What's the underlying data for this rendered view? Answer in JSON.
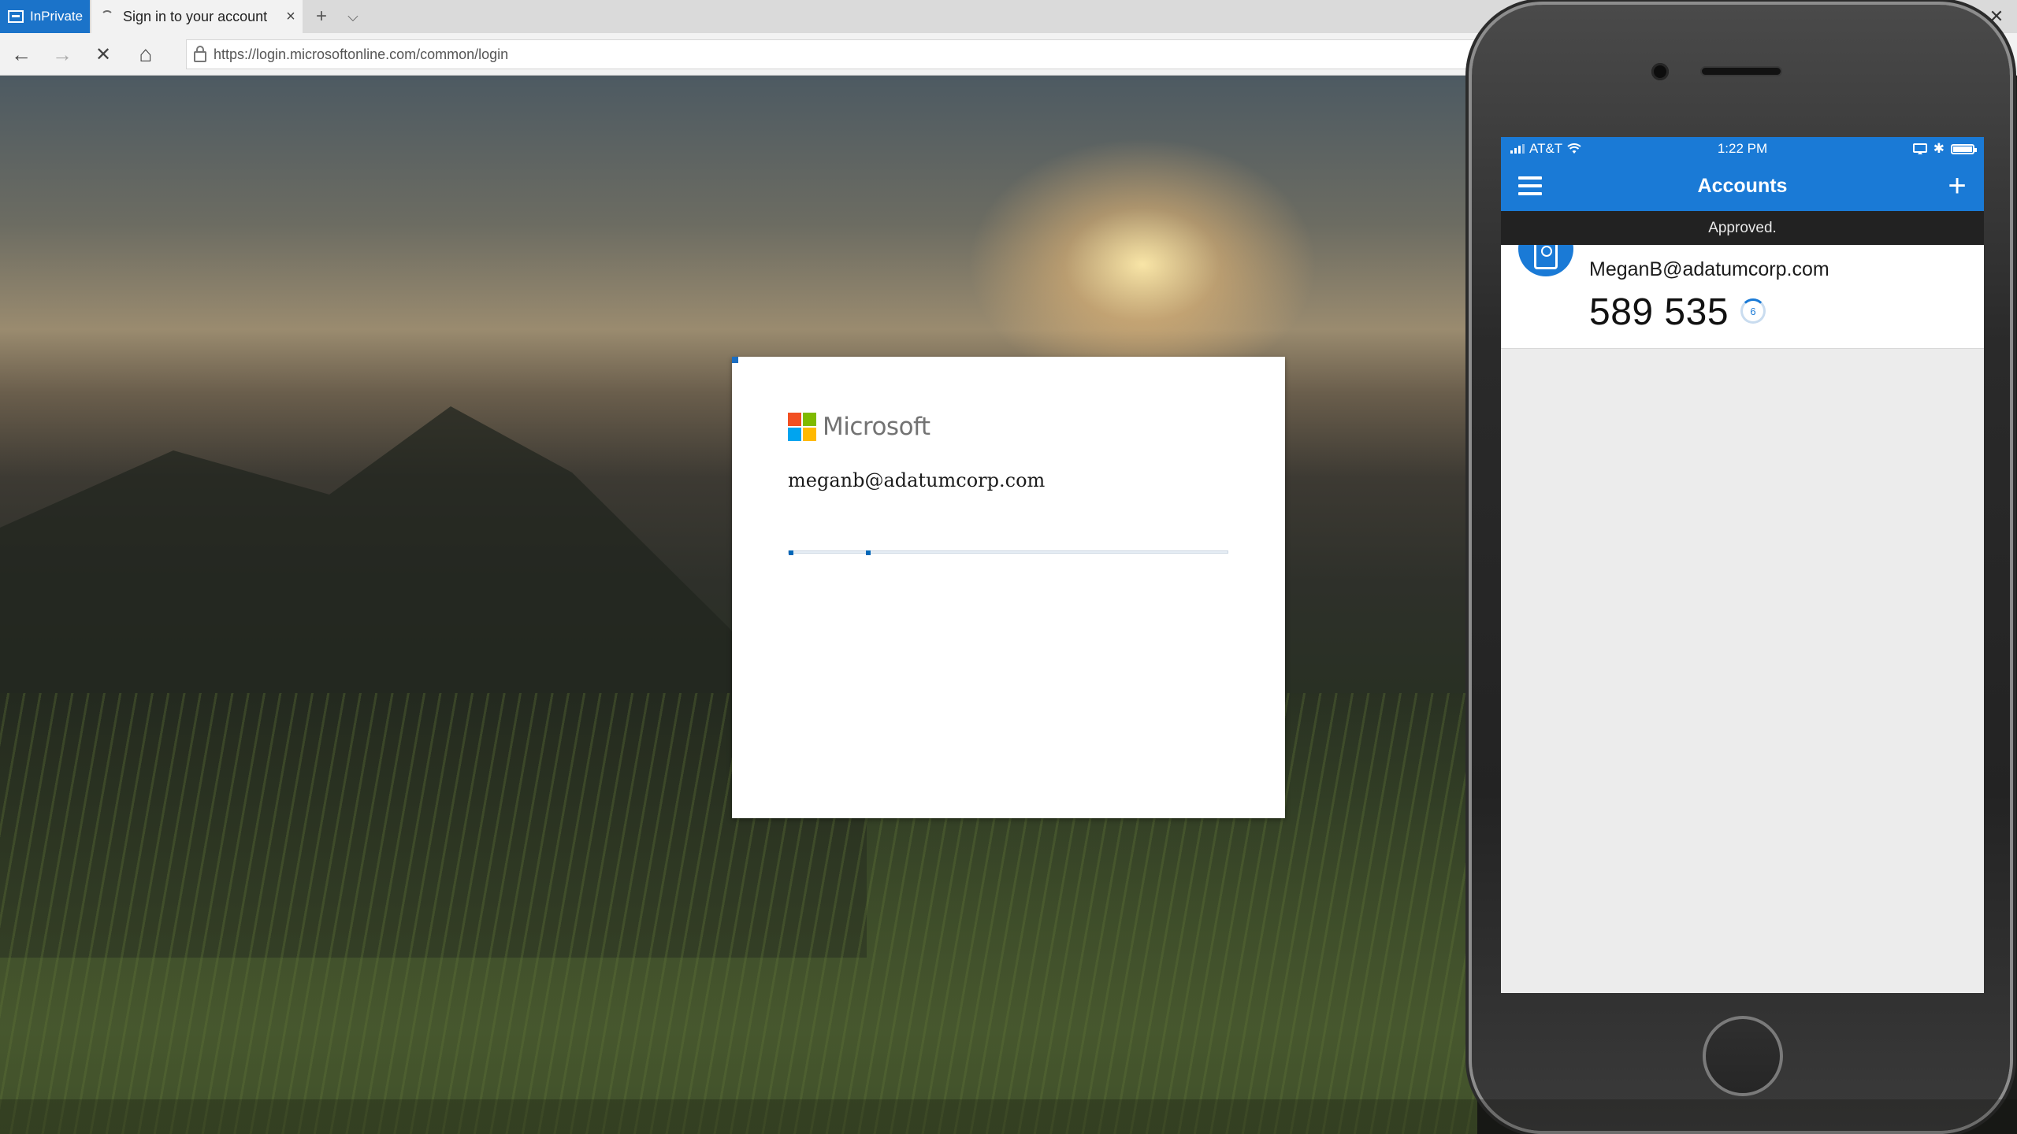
{
  "browser": {
    "inprivate_label": "InPrivate",
    "tab_title": "Sign in to your account",
    "tab_close": "×",
    "new_tab": "+",
    "tab_list": "⌵",
    "window_close": "✕",
    "nav": {
      "back": "←",
      "forward": "→",
      "stop": "✕",
      "home": "⌂"
    },
    "url": "https://login.microsoftonline.com/common/login"
  },
  "signin": {
    "brand": "Microsoft",
    "email": "meganb@adatumcorp.com",
    "logo_colors": [
      "#f25022",
      "#7fba00",
      "#00a4ef",
      "#ffb900"
    ]
  },
  "phone": {
    "carrier": "AT&T",
    "time": "1:22 PM",
    "status_icons": {
      "wifi": "wifi-icon",
      "bluetooth": "✱"
    },
    "app_title": "Accounts",
    "add_button": "+",
    "toast": "Approved.",
    "account": {
      "name": "MeganB@adatumcorp.com",
      "code": "589 535",
      "seconds_left": "6"
    },
    "accent_color": "#1a7ad6"
  }
}
